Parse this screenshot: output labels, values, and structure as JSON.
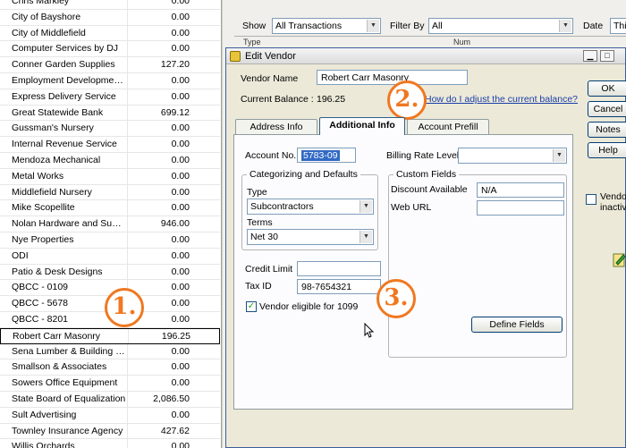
{
  "vendors": [
    {
      "name": "Chris Markley",
      "balance": "0.00"
    },
    {
      "name": "City of Bayshore",
      "balance": "0.00"
    },
    {
      "name": "City of Middlefield",
      "balance": "0.00"
    },
    {
      "name": "Computer Services by DJ",
      "balance": "0.00"
    },
    {
      "name": "Conner Garden Supplies",
      "balance": "127.20"
    },
    {
      "name": "Employment Development ...",
      "balance": "0.00"
    },
    {
      "name": "Express Delivery Service",
      "balance": "0.00"
    },
    {
      "name": "Great Statewide Bank",
      "balance": "699.12"
    },
    {
      "name": "Gussman's Nursery",
      "balance": "0.00"
    },
    {
      "name": "Internal Revenue Service",
      "balance": "0.00"
    },
    {
      "name": "Mendoza Mechanical",
      "balance": "0.00"
    },
    {
      "name": "Metal Works",
      "balance": "0.00"
    },
    {
      "name": "Middlefield Nursery",
      "balance": "0.00"
    },
    {
      "name": "Mike Scopellite",
      "balance": "0.00"
    },
    {
      "name": "Nolan Hardware and Suppl...",
      "balance": "946.00"
    },
    {
      "name": "Nye Properties",
      "balance": "0.00"
    },
    {
      "name": "ODI",
      "balance": "0.00"
    },
    {
      "name": "Patio & Desk Designs",
      "balance": "0.00"
    },
    {
      "name": "QBCC - 0109",
      "balance": "0.00"
    },
    {
      "name": "QBCC - 5678",
      "balance": "0.00"
    },
    {
      "name": "QBCC - 8201",
      "balance": "0.00"
    },
    {
      "name": "Robert Carr Masonry",
      "balance": "196.25"
    },
    {
      "name": "Sena Lumber & Building M...",
      "balance": "0.00"
    },
    {
      "name": "Smallson & Associates",
      "balance": "0.00"
    },
    {
      "name": "Sowers Office Equipment",
      "balance": "0.00"
    },
    {
      "name": "State Board of Equalization",
      "balance": "2,086.50"
    },
    {
      "name": "Sult Advertising",
      "balance": "0.00"
    },
    {
      "name": "Townley Insurance Agency",
      "balance": "427.62"
    },
    {
      "name": "Willis Orchards",
      "balance": "0.00"
    }
  ],
  "selected_vendor_index": 21,
  "toolbar": {
    "show_label": "Show",
    "show_value": "All Transactions",
    "filter_label": "Filter By",
    "filter_value": "All",
    "date_label": "Date",
    "date_value": "This"
  },
  "columns": {
    "type": "Type",
    "num": "Num"
  },
  "dialog": {
    "title": "Edit Vendor",
    "vendor_name_label": "Vendor Name",
    "vendor_name": "Robert Carr Masonry",
    "balance_label": "Current Balance :",
    "balance": "196.25",
    "help_link": "How do I adjust the current balance?",
    "tabs": [
      "Address Info",
      "Additional Info",
      "Account Prefill"
    ],
    "account_no_label": "Account No.",
    "account_no": "5783-09",
    "billing_rate_label": "Billing Rate Level",
    "billing_rate_value": "",
    "cat_group": "Categorizing and Defaults",
    "type_label": "Type",
    "type_value": "Subcontractors",
    "terms_label": "Terms",
    "terms_value": "Net 30",
    "custom_group": "Custom Fields",
    "discount_label": "Discount Available",
    "discount_value": "N/A",
    "web_label": "Web URL",
    "web_value": "",
    "credit_limit_label": "Credit Limit",
    "credit_limit": "",
    "tax_id_label": "Tax ID",
    "tax_id": "98-7654321",
    "eligible_1099_label": "Vendor eligible for 1099",
    "define_fields": "Define Fields",
    "buttons": [
      "OK",
      "Cancel",
      "Notes",
      "Help"
    ],
    "inactive_label_1": "Vendor is",
    "inactive_label_2": "inactive"
  },
  "callouts": [
    "1.",
    "2.",
    "3."
  ],
  "colors": {
    "callout": "#f07820",
    "selection": "#316ac5",
    "link": "#1a3ea8"
  }
}
